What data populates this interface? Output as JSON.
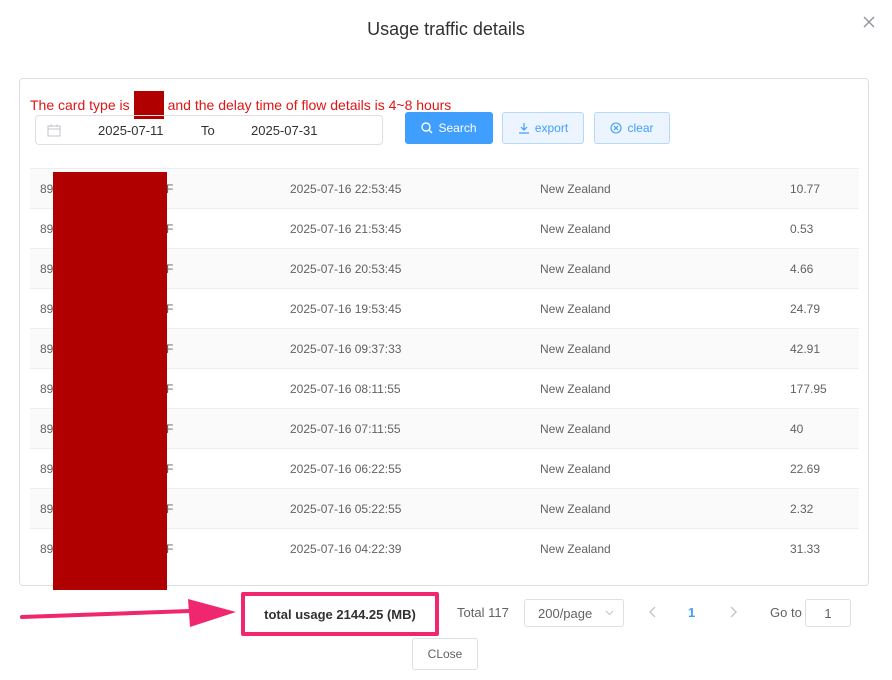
{
  "dialog": {
    "title": "Usage traffic details",
    "close_icon": "close-icon",
    "close_button_label": "CLose"
  },
  "notice": {
    "before": "The card type is",
    "after": "and the delay time of flow details is 4~8 hours",
    "color": "#e01515"
  },
  "date_range": {
    "start": "2025-07-11",
    "separator": "To",
    "end": "2025-07-31",
    "icon": "calendar-icon"
  },
  "toolbar": {
    "search_label": "Search",
    "export_label": "export",
    "clear_label": "clear",
    "accent": "#409eff"
  },
  "table": {
    "rows": [
      {
        "id_prefix": "89",
        "id_suffix": "F",
        "time": "2025-07-16 22:53:45",
        "country": "New Zealand",
        "usage": "10.77"
      },
      {
        "id_prefix": "89",
        "id_suffix": "F",
        "time": "2025-07-16 21:53:45",
        "country": "New Zealand",
        "usage": "0.53"
      },
      {
        "id_prefix": "89",
        "id_suffix": "F",
        "time": "2025-07-16 20:53:45",
        "country": "New Zealand",
        "usage": "4.66"
      },
      {
        "id_prefix": "89",
        "id_suffix": "F",
        "time": "2025-07-16 19:53:45",
        "country": "New Zealand",
        "usage": "24.79"
      },
      {
        "id_prefix": "89",
        "id_suffix": "F",
        "time": "2025-07-16 09:37:33",
        "country": "New Zealand",
        "usage": "42.91"
      },
      {
        "id_prefix": "89",
        "id_suffix": "F",
        "time": "2025-07-16 08:11:55",
        "country": "New Zealand",
        "usage": "177.95"
      },
      {
        "id_prefix": "89",
        "id_suffix": "F",
        "time": "2025-07-16 07:11:55",
        "country": "New Zealand",
        "usage": "40"
      },
      {
        "id_prefix": "89",
        "id_suffix": "F",
        "time": "2025-07-16 06:22:55",
        "country": "New Zealand",
        "usage": "22.69"
      },
      {
        "id_prefix": "89",
        "id_suffix": "F",
        "time": "2025-07-16 05:22:55",
        "country": "New Zealand",
        "usage": "2.32"
      },
      {
        "id_prefix": "89",
        "id_suffix": "F",
        "time": "2025-07-16 04:22:39",
        "country": "New Zealand",
        "usage": "31.33"
      }
    ]
  },
  "summary": {
    "total_usage": "total usage 2144.25 (MB)",
    "highlight_color": "#f0266e"
  },
  "pagination": {
    "total": "Total 117",
    "page_size": "200/page",
    "current_page": "1",
    "goto_label": "Go to",
    "goto_value": "1"
  },
  "redaction_color": "#b10000"
}
